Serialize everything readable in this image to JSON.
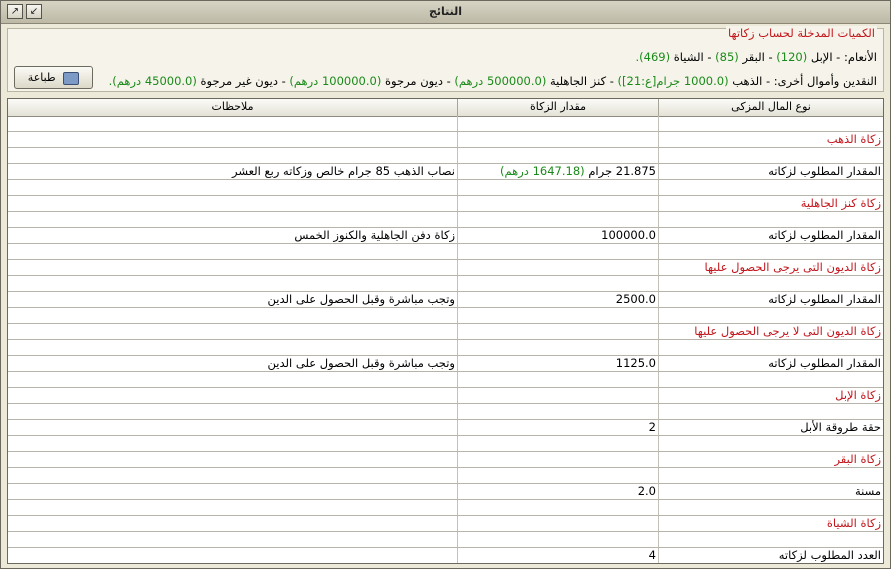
{
  "window": {
    "title": "النتائج"
  },
  "summary": {
    "legend": "الكميات المدخلة لحساب زكاتها",
    "livestock_label": "الأنعام:",
    "livestock": [
      {
        "text": " - الإبل ",
        "value": "(120)"
      },
      {
        "text": " - البقر ",
        "value": "(85)"
      },
      {
        "text": " - الشياة ",
        "value": "(469)."
      }
    ],
    "money_label": "النقدين وأموال أخرى:",
    "money": [
      {
        "text": " - الذهب ",
        "value": "(1000.0 جرام[ع:21])"
      },
      {
        "text": " - كنز الجاهلية ",
        "value": "(500000.0 درهم)"
      },
      {
        "text": " - ديون مرجوة ",
        "value": "(100000.0 درهم)"
      },
      {
        "text": " - ديون غير مرجوة ",
        "value": "(45000.0 درهم)."
      }
    ],
    "print_label": "طباعة"
  },
  "table": {
    "headers": [
      "نوع المال المزكى",
      "مقدار الزكاة",
      "ملاحظات"
    ],
    "rows": [
      {
        "type": "empty",
        "c1": "",
        "c2": "",
        "c3": ""
      },
      {
        "type": "section",
        "c1": "زكاة الذهب",
        "c2": "",
        "c3": ""
      },
      {
        "type": "empty",
        "c1": "",
        "c2": "",
        "c3": ""
      },
      {
        "type": "data",
        "c1": "المقدار المطلوب لزكاته",
        "c2": "21.875 جرام",
        "c2_extra": "(1647.18 درهم)",
        "c3": "نصاب الذهب 85 جرام خالص وزكاته ربع العشر"
      },
      {
        "type": "empty",
        "c1": "",
        "c2": "",
        "c3": ""
      },
      {
        "type": "section",
        "c1": "زكاة كنز الجاهلية",
        "c2": "",
        "c3": ""
      },
      {
        "type": "empty",
        "c1": "",
        "c2": "",
        "c3": ""
      },
      {
        "type": "data",
        "c1": "المقدار المطلوب لزكاته",
        "c2": "100000.0",
        "c3": "زكاة دفن الجاهلية والكنوز الخمس"
      },
      {
        "type": "empty",
        "c1": "",
        "c2": "",
        "c3": ""
      },
      {
        "type": "section",
        "c1": "زكاة الديون التى يرجى الحصول عليها",
        "c2": "",
        "c3": ""
      },
      {
        "type": "empty",
        "c1": "",
        "c2": "",
        "c3": ""
      },
      {
        "type": "data",
        "c1": "المقدار المطلوب لزكاته",
        "c2": "2500.0",
        "c3": "وتجب مباشرة وقبل الحصول على الدين"
      },
      {
        "type": "empty",
        "c1": "",
        "c2": "",
        "c3": ""
      },
      {
        "type": "section",
        "c1": "زكاة الديون التى لا يرجى الحصول عليها",
        "c2": "",
        "c3": ""
      },
      {
        "type": "empty",
        "c1": "",
        "c2": "",
        "c3": ""
      },
      {
        "type": "data",
        "c1": "المقدار المطلوب لزكاته",
        "c2": "1125.0",
        "c3": "وتجب مباشرة وقبل الحصول على الدين"
      },
      {
        "type": "empty",
        "c1": "",
        "c2": "",
        "c3": ""
      },
      {
        "type": "section",
        "c1": "زكاة الإبل",
        "c2": "",
        "c3": ""
      },
      {
        "type": "empty",
        "c1": "",
        "c2": "",
        "c3": ""
      },
      {
        "type": "data",
        "c1": "حقة طروقة الأبل",
        "c2": "2",
        "c3": ""
      },
      {
        "type": "empty",
        "c1": "",
        "c2": "",
        "c3": ""
      },
      {
        "type": "section",
        "c1": "زكاة البقر",
        "c2": "",
        "c3": ""
      },
      {
        "type": "empty",
        "c1": "",
        "c2": "",
        "c3": ""
      },
      {
        "type": "data",
        "c1": "مسنة",
        "c2": "2.0",
        "c3": ""
      },
      {
        "type": "empty",
        "c1": "",
        "c2": "",
        "c3": ""
      },
      {
        "type": "section",
        "c1": "زكاة الشياة",
        "c2": "",
        "c3": ""
      },
      {
        "type": "empty",
        "c1": "",
        "c2": "",
        "c3": ""
      },
      {
        "type": "data",
        "c1": "العدد المطلوب لزكاته",
        "c2": "4",
        "c3": ""
      }
    ]
  }
}
